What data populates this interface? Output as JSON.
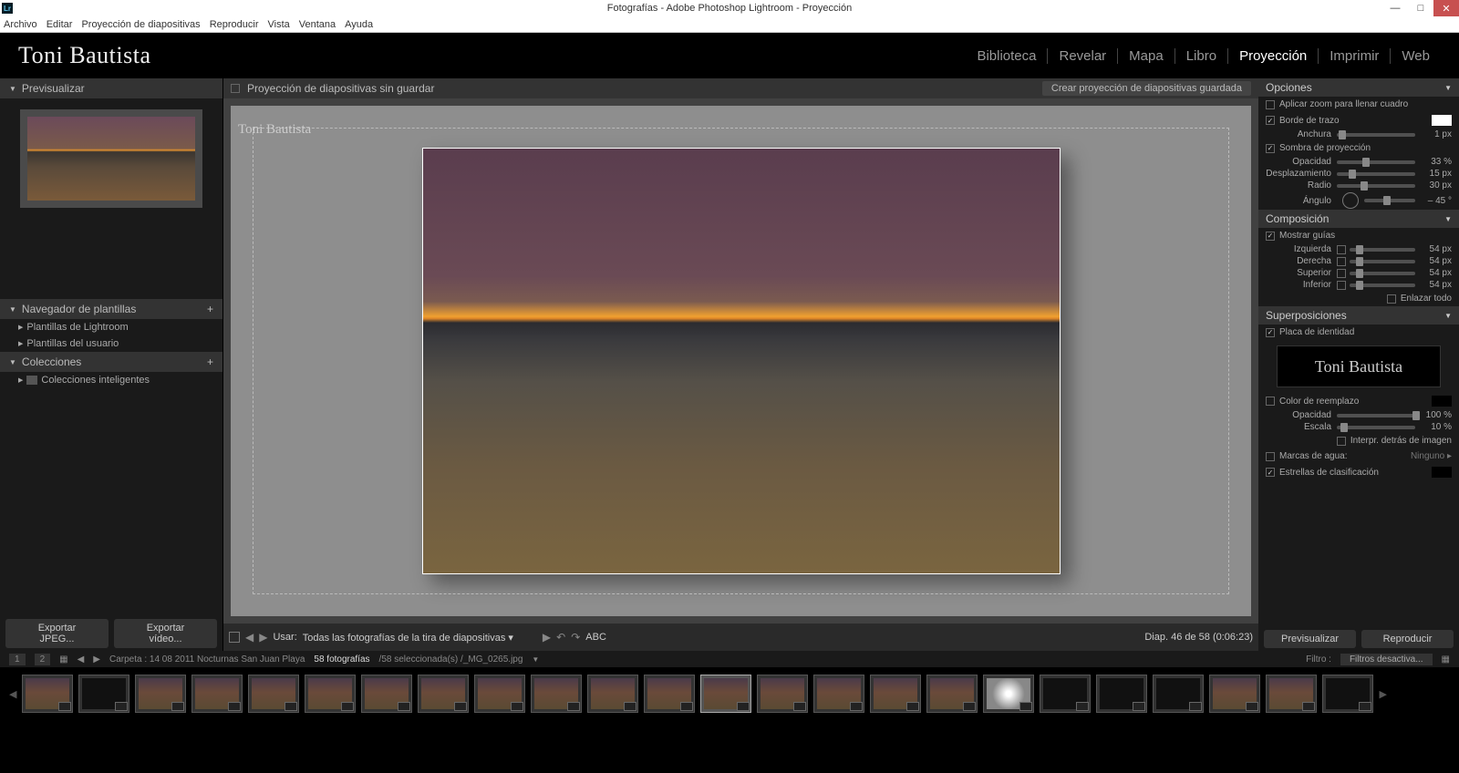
{
  "titlebar": {
    "title": "Fotografías - Adobe Photoshop Lightroom - Proyección",
    "icon": "Lr"
  },
  "menubar": [
    "Archivo",
    "Editar",
    "Proyección de diapositivas",
    "Reproducir",
    "Vista",
    "Ventana",
    "Ayuda"
  ],
  "identity": "Toni Bautista",
  "modules": [
    {
      "label": "Biblioteca",
      "active": false
    },
    {
      "label": "Revelar",
      "active": false
    },
    {
      "label": "Mapa",
      "active": false
    },
    {
      "label": "Libro",
      "active": false
    },
    {
      "label": "Proyección",
      "active": true
    },
    {
      "label": "Imprimir",
      "active": false
    },
    {
      "label": "Web",
      "active": false
    }
  ],
  "left": {
    "preview_header": "Previsualizar",
    "template_header": "Navegador de plantillas",
    "template_items": [
      "Plantillas de Lightroom",
      "Plantillas del usuario"
    ],
    "collections_header": "Colecciones",
    "collections_items": [
      "Colecciones inteligentes"
    ],
    "export_jpeg": "Exportar JPEG...",
    "export_video": "Exportar vídeo..."
  },
  "center": {
    "header_title": "Proyección de diapositivas sin guardar",
    "save_btn": "Crear proyección de diapositivas guardada",
    "canvas_identity": "Toni Bautista",
    "slide_info": "Diap. 46 de 58 (0:06:23)",
    "use_label": "Usar:",
    "use_value": "Todas las fotografías de la tira de diapositivas",
    "abc": "ABC"
  },
  "right": {
    "opciones": {
      "header": "Opciones",
      "zoom": "Aplicar zoom para llenar cuadro",
      "borde": "Borde de trazo",
      "anchura_label": "Anchura",
      "anchura_val": "1 px",
      "sombra": "Sombra de proyección",
      "opacidad_label": "Opacidad",
      "opacidad_val": "33 %",
      "desplaz_label": "Desplazamiento",
      "desplaz_val": "15 px",
      "radio_label": "Radio",
      "radio_val": "30 px",
      "angulo_label": "Ángulo",
      "angulo_val": "– 45 °"
    },
    "composicion": {
      "header": "Composición",
      "mostrar": "Mostrar guías",
      "izq_label": "Izquierda",
      "izq_val": "54 px",
      "der_label": "Derecha",
      "der_val": "54 px",
      "sup_label": "Superior",
      "sup_val": "54 px",
      "inf_label": "Inferior",
      "inf_val": "54 px",
      "enlazar": "Enlazar todo"
    },
    "super": {
      "header": "Superposiciones",
      "placa": "Placa de identidad",
      "plate_text": "Toni Bautista",
      "color_reemplazo": "Color de reemplazo",
      "opacidad_label": "Opacidad",
      "opacidad_val": "100 %",
      "escala_label": "Escala",
      "escala_val": "10 %",
      "interpr": "Interpr. detrás de imagen",
      "marcas_label": "Marcas de agua:",
      "marcas_val": "Ninguno ▸",
      "estrellas": "Estrellas de clasificación"
    },
    "previsualizar": "Previsualizar",
    "reproducir": "Reproducir"
  },
  "info": {
    "page1": "1",
    "page2": "2",
    "folder": "Carpeta : 14 08 2011 Nocturnas San Juan Playa",
    "count": "58 fotografías",
    "sel": "/58 seleccionada(s) /_MG_0265.jpg",
    "filter_label": "Filtro :",
    "filter_val": "Filtros desactiva..."
  }
}
